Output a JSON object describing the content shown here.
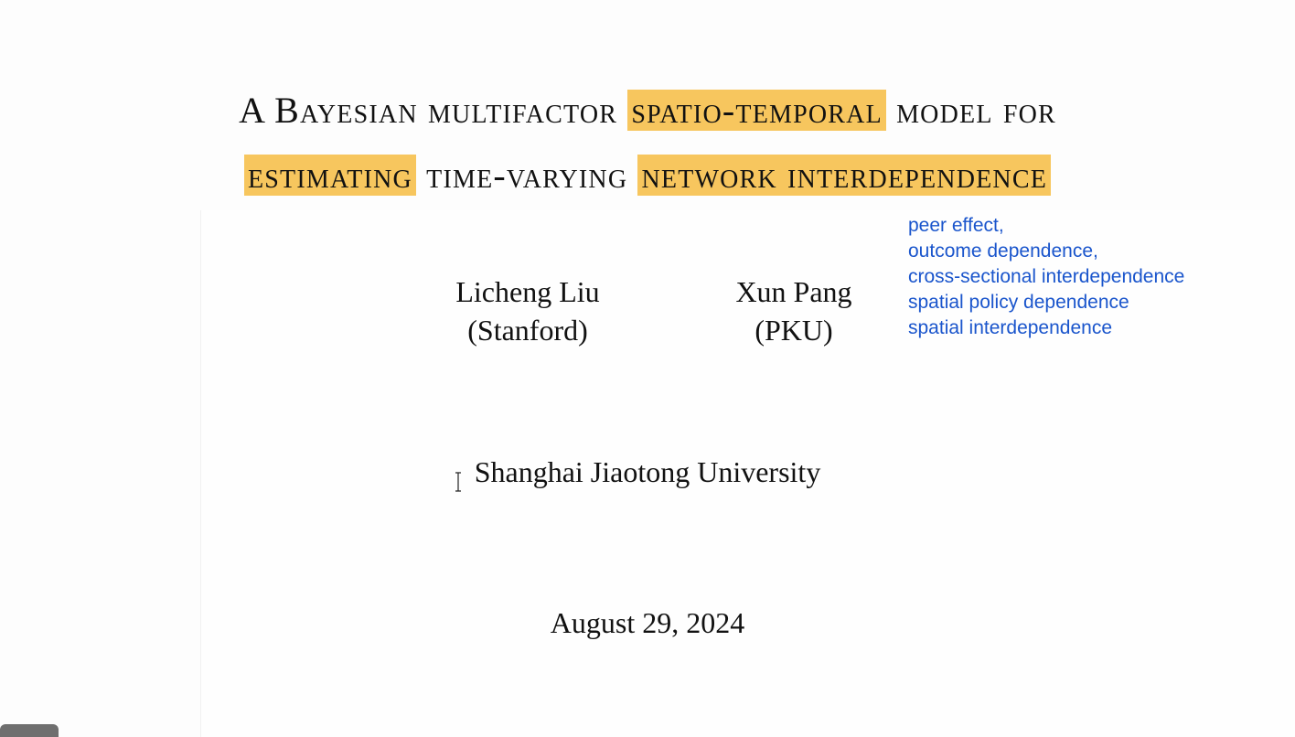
{
  "title": {
    "line1": [
      {
        "text": "A Bayesian multifactor ",
        "highlight": false
      },
      {
        "text": "spatio-temporal",
        "highlight": true
      },
      {
        "text": " model for",
        "highlight": false
      }
    ],
    "line2": [
      {
        "text": "estimating",
        "highlight": true
      },
      {
        "text": " time-varying ",
        "highlight": false
      },
      {
        "text": "network interdependence",
        "highlight": true
      }
    ]
  },
  "authors": [
    {
      "name": "Licheng Liu",
      "affiliation": "(Stanford)"
    },
    {
      "name": "Xun Pang",
      "affiliation": "(PKU)"
    }
  ],
  "annotations": [
    "peer effect,",
    "outcome dependence,",
    "cross-sectional interdependence",
    "spatial policy dependence",
    "spatial interdependence"
  ],
  "venue": "Shanghai Jiaotong University",
  "date": "August 29, 2024",
  "colors": {
    "highlight": "#f7c65e",
    "annotation_text": "#1a55cc"
  }
}
